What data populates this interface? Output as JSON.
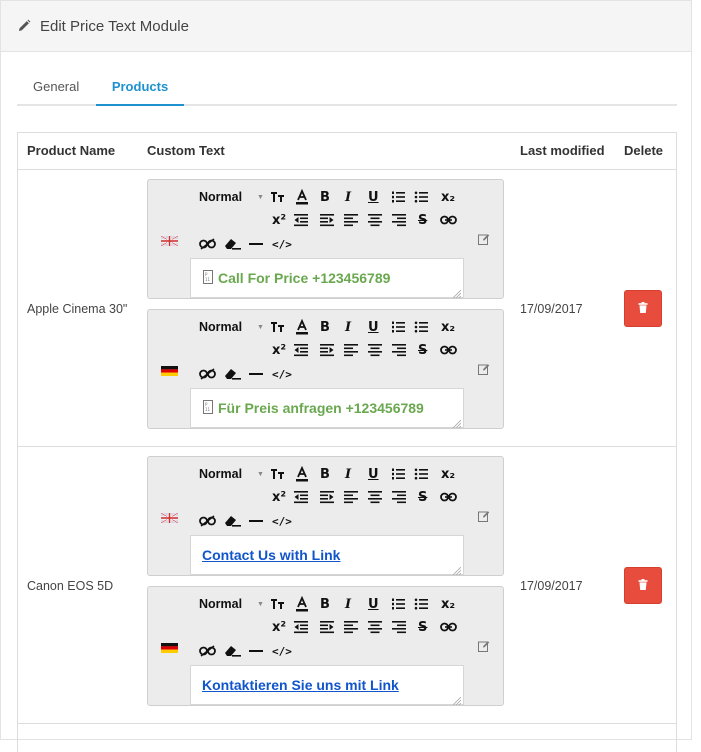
{
  "panel": {
    "title": "Edit Price Text Module"
  },
  "tabs": [
    {
      "label": "General",
      "active": false
    },
    {
      "label": "Products",
      "active": true
    }
  ],
  "table": {
    "headers": {
      "product_name": "Product Name",
      "custom_text": "Custom Text",
      "last_modified": "Last modified",
      "delete": "Delete"
    }
  },
  "toolbar": {
    "format": "Normal",
    "superscript": "x²",
    "subscript": "x₂"
  },
  "rows": [
    {
      "product_name": "Apple Cinema 30\"",
      "last_modified": "17/09/2017",
      "editors": [
        {
          "language": "english-flag",
          "text": "Call For Price +123456789",
          "style": "green-bold"
        },
        {
          "language": "german-flag",
          "text": "Für Preis anfragen +123456789",
          "style": "green-bold"
        }
      ]
    },
    {
      "product_name": "Canon EOS 5D",
      "last_modified": "17/09/2017",
      "editors": [
        {
          "language": "english-flag",
          "text": "Contact Us with Link",
          "style": "link"
        },
        {
          "language": "german-flag",
          "text": "Kontaktieren Sie uns mit Link",
          "style": "link"
        }
      ]
    }
  ],
  "colors": {
    "accent": "#1e91cf",
    "danger": "#e74c3c",
    "green_text": "#6aa84f",
    "link_text": "#1155cc"
  }
}
